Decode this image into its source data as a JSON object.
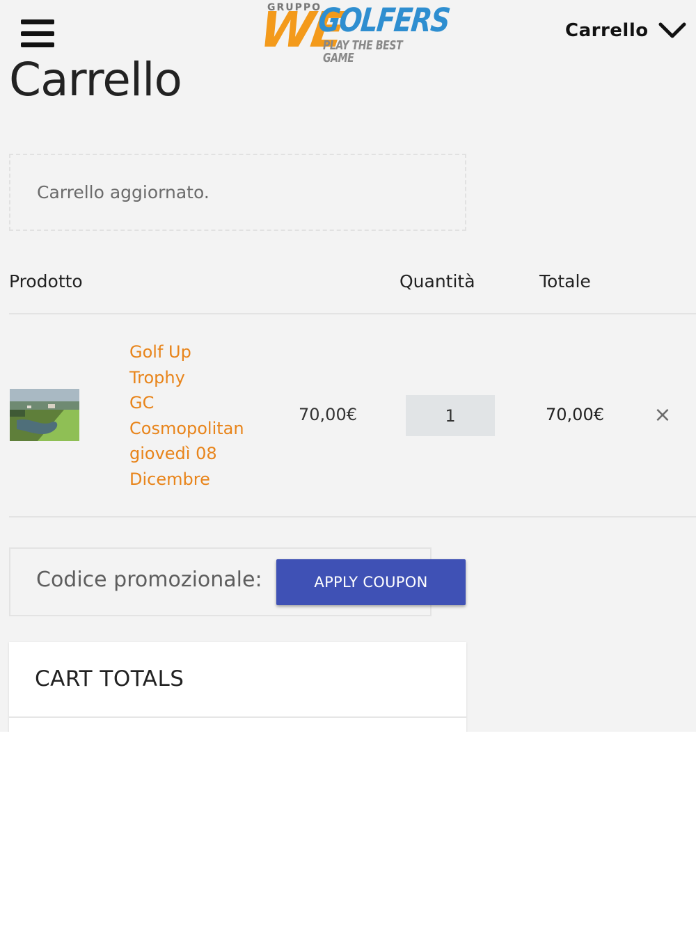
{
  "header": {
    "menu_icon": "hamburger-menu-icon",
    "logo": {
      "top_text": "GRUPPO",
      "brand_left": "WE",
      "brand_right": "GOLFERS",
      "tagline": "PLAY THE BEST GAME",
      "colors": {
        "we": "#f39a1b",
        "golfers": "#2e8ed0",
        "tagline": "#888888"
      }
    },
    "cart_menu_label": "Carrello",
    "cart_menu_icon": "chevron-down-icon"
  },
  "page_title": "Carrello",
  "notice": "Carrello aggiornato.",
  "table": {
    "headers": {
      "product": "Prodotto",
      "quantity": "Quantità",
      "total": "Totale"
    },
    "rows": [
      {
        "name_lines": [
          "Golf Up",
          "Trophy",
          "GC",
          "Cosmopolitan",
          "giovedì 08",
          "Dicembre"
        ],
        "price": "70,00€",
        "quantity": "1",
        "total": "70,00€",
        "remove_symbol": "×"
      }
    ]
  },
  "coupon": {
    "label": "Codice promozionale:",
    "button": "APPLY COUPON"
  },
  "cart_totals": {
    "title": "CART TOTALS"
  },
  "colors": {
    "accent": "#3f51b5",
    "product_link": "#e8841a",
    "background": "#f3f3f3"
  }
}
